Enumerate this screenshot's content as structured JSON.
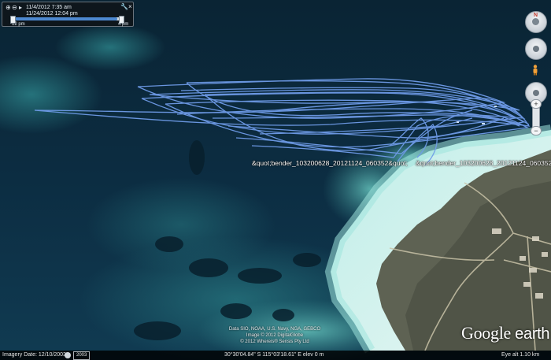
{
  "time_slider": {
    "start_time": "11/4/2012  7:35 am",
    "end_time": "11/24/2012  12:04 pm",
    "left_label": "12 pm",
    "right_label": "4 pm"
  },
  "navigation": {
    "compass_letter": "N",
    "zoom_in": "+",
    "zoom_out": "−"
  },
  "tracks": {
    "label_a": "&quot;bender_103200628_20121124_060352&quot;",
    "label_b": "&quot;bender_103200628_20121124_060352",
    "track_color": "#6f9be8"
  },
  "credits": [
    "Data SIO, NOAA, U.S. Navy, NGA, GEBCO",
    "Image © 2012 DigitalGlobe",
    "© 2012 Whereis® Sensis Pty Ltd"
  ],
  "logo": {
    "google": "Google",
    "earth": "earth"
  },
  "status_bar": {
    "imagery_date": "Imagery Date: 12/10/2003",
    "year": "2003",
    "coords": "30°30'04.84\" S  115°03'18.61\" E  elev    0 m",
    "eye_alt": "Eye alt    1.10 km"
  },
  "icons": [
    "play-icon",
    "zoom-in-icon",
    "zoom-out-icon",
    "wrench-icon",
    "close-icon",
    "compass-icon",
    "look-icon",
    "pegman-icon",
    "move-icon",
    "clock-icon"
  ]
}
